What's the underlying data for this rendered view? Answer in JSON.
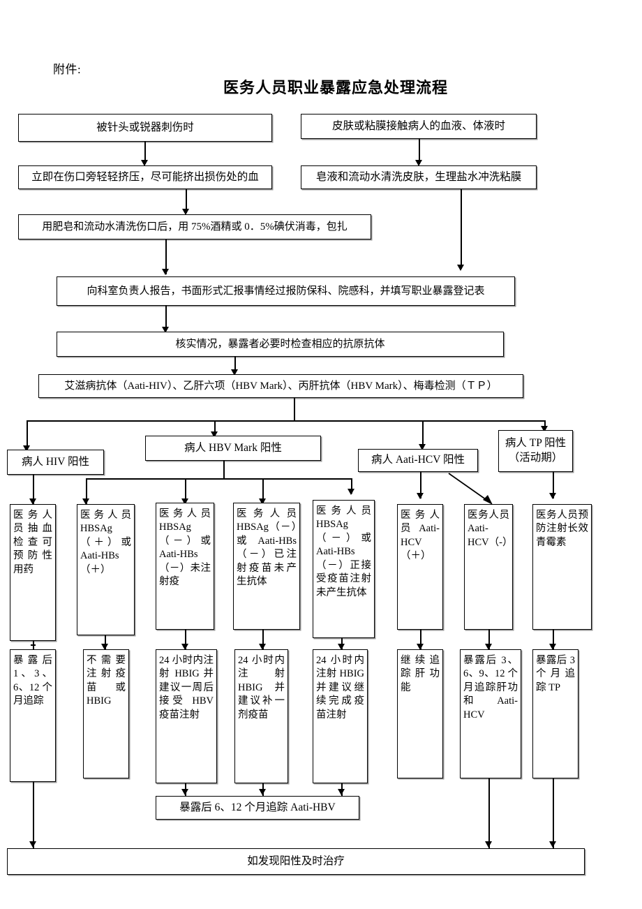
{
  "header": {
    "attachment_label": "附件:",
    "title": "医务人员职业暴露应急处理流程"
  },
  "nodes": {
    "n1": "被针头或锐器刺伤时",
    "n2": "皮肤或粘膜接触病人的血液、体液时",
    "n3": "立即在伤口旁轻轻挤压，尽可能挤出损伤处的血",
    "n4": "皂液和流动水清洗皮肤，生理盐水冲洗粘膜",
    "n5": "用肥皂和流动水清洗伤口后，用 75%酒精或 0．5%碘伏消毒，包扎",
    "n6": "向科室负责人报告，书面形式汇报事情经过报防保科、院感科，并填写职业暴露登记表",
    "n7": "核实情况，暴露者必要时检查相应的抗原抗体",
    "n8": "艾滋病抗体（Aati-HIV）、乙肝六项（HBV Mark）、丙肝抗体（HBV Mark）、梅毒检测（ＴＰ）",
    "b_hiv": "病人 HIV 阳性",
    "b_hbv": "病人 HBV Mark 阳性",
    "b_hcv": "病人 Aati-HCV 阳性",
    "b_tp": "病人 TP 阳性（活动期）",
    "m1": "医务人员抽血检查可预防性用药",
    "m2": "医务人员 HBSAg（＋）或 Aati-HBs（＋）",
    "m3": "医务人员 HBSAg（－）或 Aati-HBs（－）未注射疫",
    "m4": "医务人员 HBSAg（－）或 Aati-HBs（－）已注射疫苗未产生抗体",
    "m5": "医务人员 HBSAg（－）或 Aati-HBs（－）正接受疫苗注射未产生抗体",
    "m6": "医务人员 Aati-HCV（＋）",
    "m7": "医务人员 Aati-HCV（-）",
    "m8": "医务人员预防注射长效青霉素",
    "r1": "暴露后 1、3、6、12 个月追踪",
    "r2": "不需要注射疫苗或 HBIG",
    "r3": "24 小时内注射 HBIG 并建议一周后接受 HBV 疫苗注射",
    "r4": "24 小时内注射 HBIG 并建议补一剂疫苗",
    "r5": "24 小时内注射 HBIG 并建议继续完成疫苗注射",
    "r6": "继续追踪肝功能",
    "r7": "暴露后 3、6、9、12 个月追踪肝功和 Aati-HCV",
    "r8": "暴露后 3 个月追踪 TP",
    "f1": "暴露后 6、12 个月追踪 Aati-HBV",
    "f2": "如发现阳性及时治疗"
  },
  "colors": {
    "line": "#000000",
    "box_border": "#000000",
    "box_shadow": "#9a9a9a",
    "background": "#ffffff"
  }
}
